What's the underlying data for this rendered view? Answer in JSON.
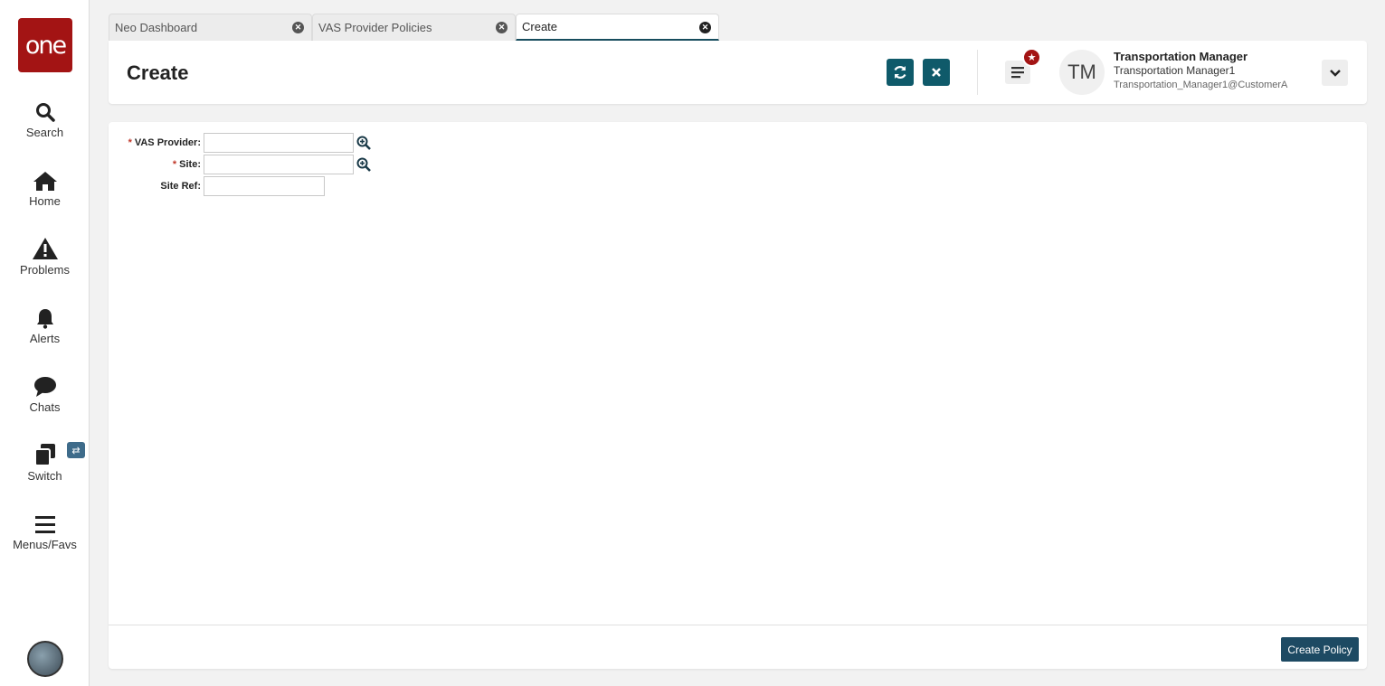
{
  "sidebar": {
    "logo_text": "one",
    "items": [
      {
        "label": "Search",
        "icon": "search-icon"
      },
      {
        "label": "Home",
        "icon": "home-icon"
      },
      {
        "label": "Problems",
        "icon": "warning-icon"
      },
      {
        "label": "Alerts",
        "icon": "bell-icon"
      },
      {
        "label": "Chats",
        "icon": "chat-icon"
      },
      {
        "label": "Switch",
        "icon": "switch-icon"
      },
      {
        "label": "Menus/Favs",
        "icon": "hamburger-icon"
      }
    ]
  },
  "tabs": [
    {
      "label": "Neo Dashboard",
      "active": false
    },
    {
      "label": "VAS Provider Policies",
      "active": false
    },
    {
      "label": "Create",
      "active": true
    }
  ],
  "header": {
    "title": "Create",
    "refresh_icon": "refresh-icon",
    "close_icon": "close-icon",
    "accent_color": "#0f5a6a"
  },
  "user": {
    "initials": "TM",
    "name": "Transportation Manager",
    "role": "Transportation Manager1",
    "email": "Transportation_Manager1@CustomerA"
  },
  "form": {
    "vas_provider": {
      "label": "VAS Provider:",
      "value": "",
      "required": true
    },
    "site": {
      "label": "Site:",
      "value": "",
      "required": true
    },
    "site_ref": {
      "label": "Site Ref:",
      "value": "",
      "required": false
    }
  },
  "footer": {
    "create_label": "Create Policy",
    "button_color": "#1d4a63"
  },
  "colors": {
    "brand": "#a31414",
    "required": "#c0392b"
  }
}
